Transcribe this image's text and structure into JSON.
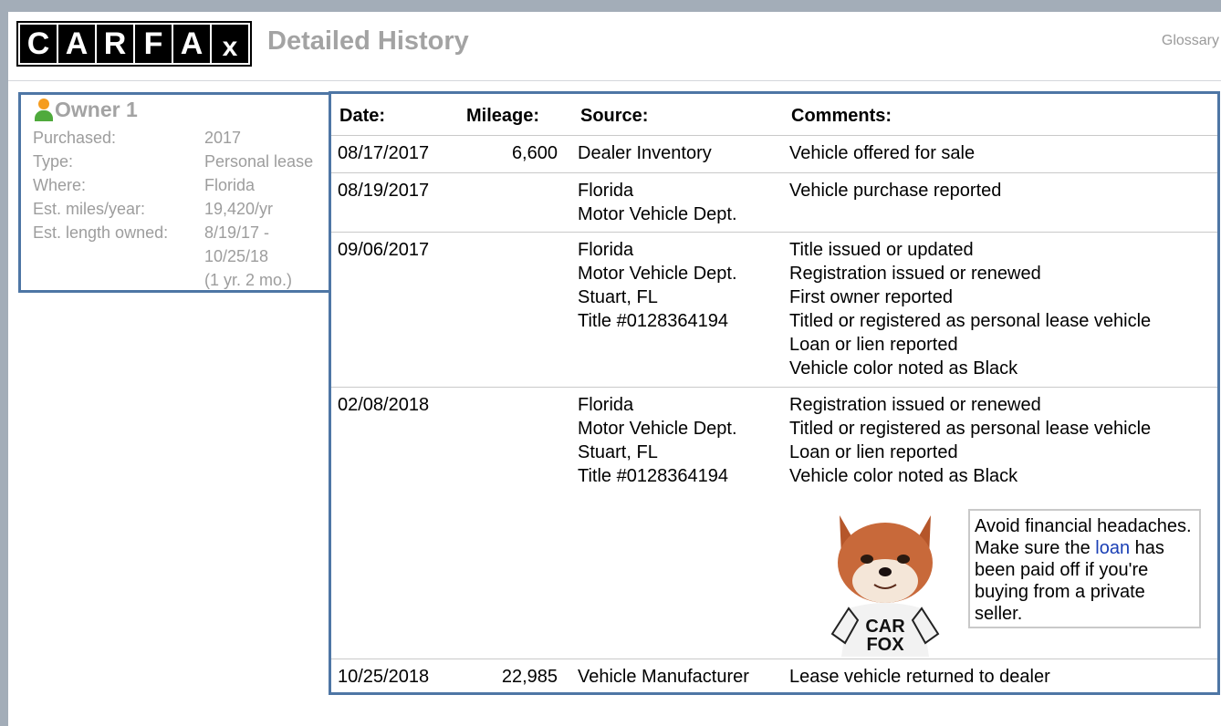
{
  "header": {
    "logo_letters": [
      "C",
      "A",
      "R",
      "F",
      "A",
      "x"
    ],
    "title": "Detailed History",
    "glossary_link": "Glossary"
  },
  "owner": {
    "title": "Owner 1",
    "rows": [
      {
        "label": "Purchased:",
        "value": [
          "2017"
        ]
      },
      {
        "label": "Type:",
        "value": [
          "Personal lease"
        ]
      },
      {
        "label": "Where:",
        "value": [
          "Florida"
        ]
      },
      {
        "label": "Est. miles/year:",
        "value": [
          "19,420/yr"
        ]
      },
      {
        "label": "Est. length owned:",
        "value": [
          "8/19/17 -",
          "10/25/18",
          "(1 yr. 2 mo.)"
        ]
      }
    ]
  },
  "table": {
    "headers": {
      "date": "Date:",
      "mileage": "Mileage:",
      "source": "Source:",
      "comments": "Comments:"
    },
    "rows": [
      {
        "date": "08/17/2017",
        "mileage": "6,600",
        "source": [
          "Dealer Inventory"
        ],
        "comments": [
          "Vehicle offered for sale"
        ]
      },
      {
        "date": "08/19/2017",
        "mileage": "",
        "source": [
          "Florida",
          "Motor Vehicle Dept."
        ],
        "comments": [
          "Vehicle purchase reported"
        ]
      },
      {
        "date": "09/06/2017",
        "mileage": "",
        "source": [
          "Florida",
          "Motor Vehicle Dept.",
          "Stuart, FL",
          "Title #0128364194"
        ],
        "comments": [
          "Title issued or updated",
          "Registration issued or renewed",
          "First owner reported",
          "Titled or registered as personal lease vehicle",
          "Loan or lien reported",
          "Vehicle color noted as Black"
        ]
      },
      {
        "date": "02/08/2018",
        "mileage": "",
        "source": [
          "Florida",
          "Motor Vehicle Dept.",
          "Stuart, FL",
          "Title #0128364194"
        ],
        "comments": [
          "Registration issued or renewed",
          "Titled or registered as personal lease vehicle",
          "Loan or lien reported",
          "Vehicle color noted as Black"
        ]
      },
      {
        "date": "10/25/2018",
        "mileage": "22,985",
        "source": [
          "Vehicle Manufacturer"
        ],
        "comments": [
          "Lease vehicle returned to dealer"
        ]
      }
    ]
  },
  "callout": {
    "text_before": "Avoid financial headaches. Make sure the",
    "link": "loan",
    "text_after": "has been paid off if you're buying from a private seller.",
    "shirt_text": "CAR FOX"
  },
  "colors": {
    "frame": "#a3adb8",
    "box_border": "#4e76a5",
    "link": "#1a3fb5"
  }
}
